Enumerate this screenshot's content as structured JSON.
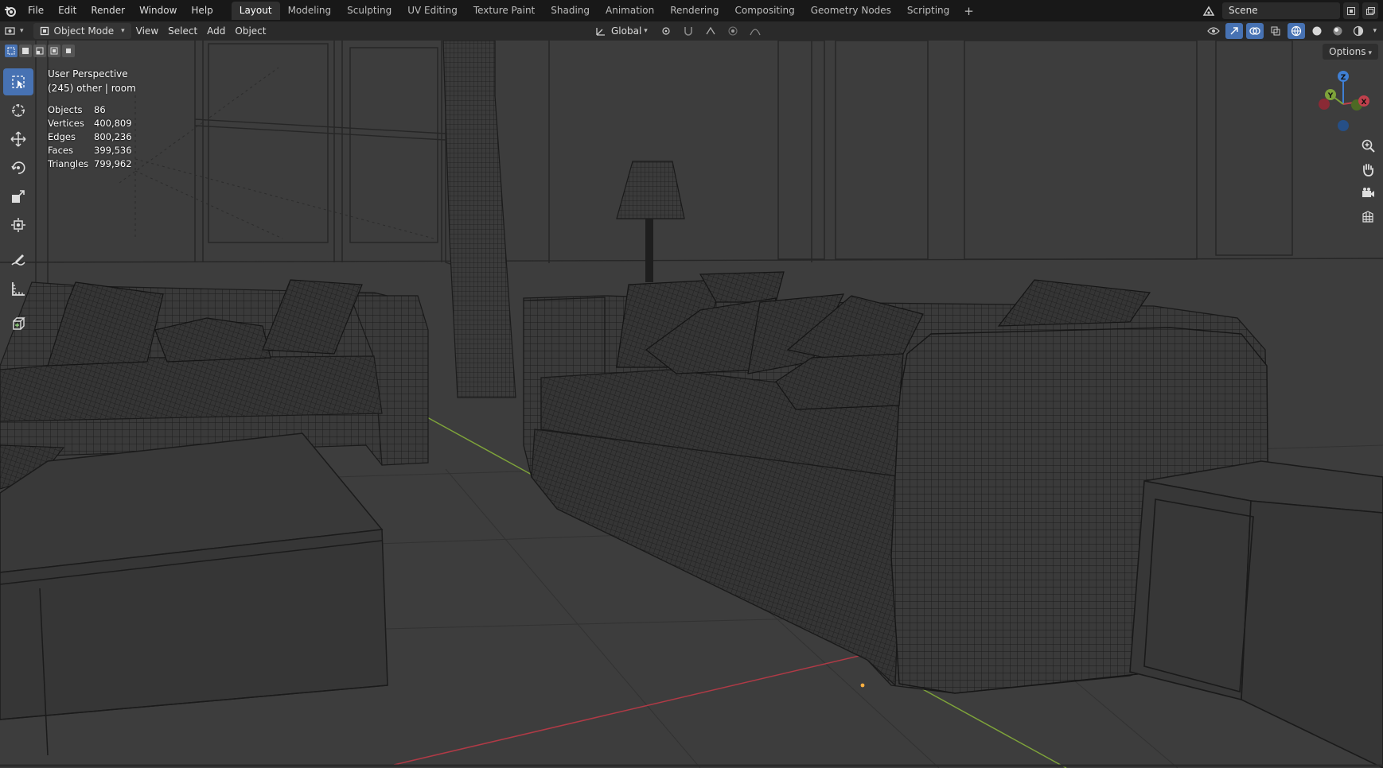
{
  "app": {
    "name": "Blender"
  },
  "topbar": {
    "menus": [
      "File",
      "Edit",
      "Render",
      "Window",
      "Help"
    ],
    "workspace_tabs": [
      "Layout",
      "Modeling",
      "Sculpting",
      "UV Editing",
      "Texture Paint",
      "Shading",
      "Animation",
      "Rendering",
      "Compositing",
      "Geometry Nodes",
      "Scripting"
    ],
    "active_tab": "Layout",
    "add_tab_label": "+",
    "scene_name": "Scene"
  },
  "header": {
    "mode": "Object Mode",
    "menus": [
      "View",
      "Select",
      "Add",
      "Object"
    ],
    "transform_orientation": "Global",
    "options_label": "Options"
  },
  "overlay": {
    "view_name": "User Perspective",
    "collection_info": "(245) other | room",
    "stats": [
      {
        "label": "Objects",
        "value": "86"
      },
      {
        "label": "Vertices",
        "value": "400,809"
      },
      {
        "label": "Edges",
        "value": "800,236"
      },
      {
        "label": "Faces",
        "value": "399,536"
      },
      {
        "label": "Triangles",
        "value": "799,962"
      }
    ]
  },
  "gizmo": {
    "axes": [
      "Z",
      "Y",
      "X"
    ]
  },
  "colors": {
    "accent": "#4772b3",
    "viewport_bg": "#3d3d3d",
    "wire": "#1a1a1a",
    "x_axis": "#c0404c",
    "y_axis": "#7ea33a",
    "z_axis": "#3f7fd4"
  },
  "toolbar_icons": [
    "select-box-icon",
    "cursor-icon",
    "move-icon",
    "rotate-icon",
    "scale-icon",
    "transform-icon",
    "annotate-icon",
    "measure-icon",
    "add-cube-icon"
  ]
}
